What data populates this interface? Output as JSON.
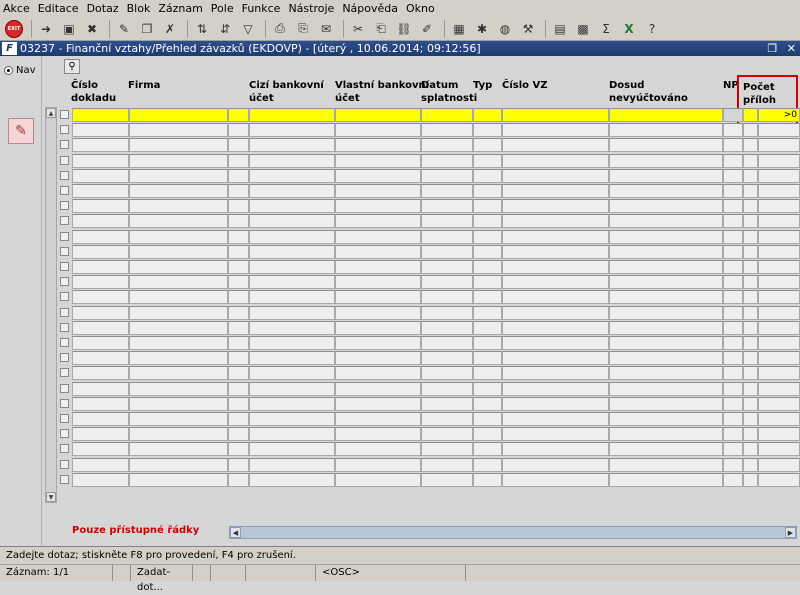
{
  "menu": {
    "items": [
      "Akce",
      "Editace",
      "Dotaz",
      "Blok",
      "Záznam",
      "Pole",
      "Funkce",
      "Nástroje",
      "Nápověda",
      "Okno"
    ]
  },
  "toolbar": {
    "exit_label": "EXIT",
    "icons": [
      "save-icon",
      "new-icon",
      "delete-icon",
      "query-icon",
      "copy-icon",
      "clear-icon",
      "sort-icon",
      "filter-icon",
      "print-icon",
      "mail-icon",
      "cut-icon",
      "paste-icon",
      "calc-icon",
      "sum-icon",
      "excel-icon",
      "help-icon"
    ]
  },
  "window": {
    "title": "03237 - Finanční vztahy/Přehled závazků (EKDOVP) - [úterý , 10.06.2014; 09:12:56]",
    "logo": "F"
  },
  "nav": {
    "radio_label": "Nav"
  },
  "table": {
    "columns": [
      {
        "id": "cislo",
        "line1": "Číslo",
        "line2": "dokladu"
      },
      {
        "id": "firma",
        "line1": "Firma",
        "line2": ""
      },
      {
        "id": "cizi",
        "line1": "Cizí bankovní",
        "line2": "účet"
      },
      {
        "id": "vlastni",
        "line1": "Vlastní bankovní",
        "line2": "účet"
      },
      {
        "id": "datum",
        "line1": "Datum",
        "line2": "splatnosti"
      },
      {
        "id": "typ",
        "line1": "Typ",
        "line2": ""
      },
      {
        "id": "vz",
        "line1": "Číslo VZ",
        "line2": ""
      },
      {
        "id": "dosud",
        "line1": "Dosud",
        "line2": "nevyúčtováno"
      },
      {
        "id": "np",
        "line1": "NP",
        "line2": ""
      },
      {
        "id": "pocet",
        "line1": "Počet",
        "line2": "příloh"
      }
    ],
    "first_row_pocet": ">0",
    "row_count": 25
  },
  "footer": {
    "filter_note": "Pouze přístupné řádky"
  },
  "status": {
    "message": "Zadejte dotaz; stiskněte F8 pro provedení, F4 pro zrušení.",
    "record": "Záznam: 1/1",
    "mode": "Zadat-dot...",
    "osc": "<OSC>"
  }
}
